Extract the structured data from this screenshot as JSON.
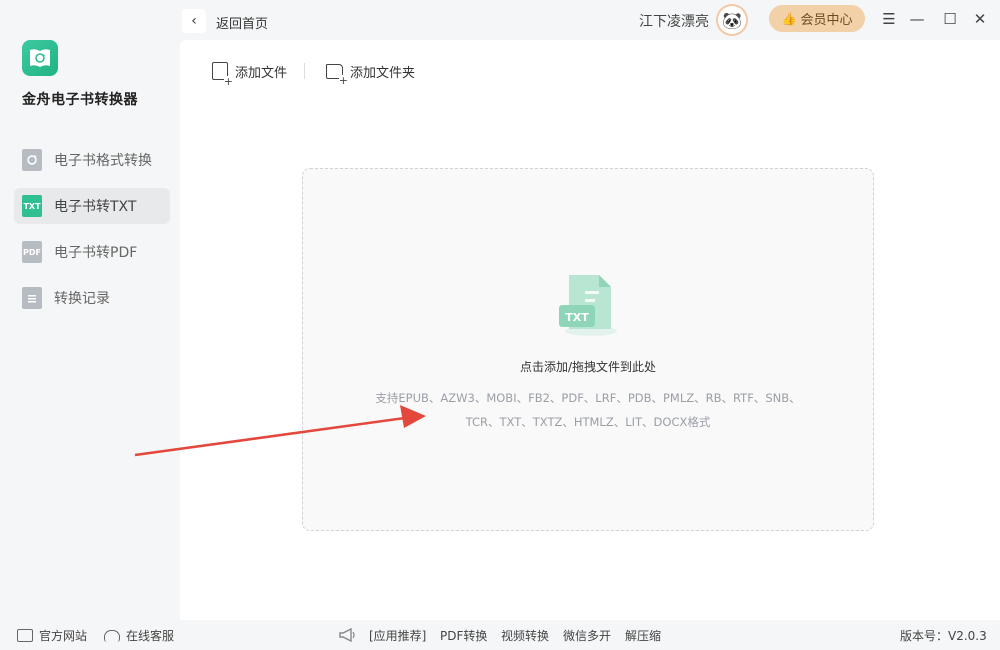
{
  "app": {
    "name": "金舟电子书转换器",
    "accent": "#2fbf91"
  },
  "sidebar": {
    "items": [
      {
        "label": "电子书格式转换",
        "icon": "refresh-book-icon"
      },
      {
        "label": "电子书转TXT",
        "icon": "txt-file-icon",
        "icon_text": "TXT"
      },
      {
        "label": "电子书转PDF",
        "icon": "pdf-file-icon",
        "icon_text": "PDF"
      },
      {
        "label": "转换记录",
        "icon": "list-record-icon"
      }
    ],
    "active": 1
  },
  "header": {
    "back_label": "返回首页",
    "username": "江下凌漂亮",
    "vip_label": "会员中心"
  },
  "toolbar": {
    "add_file": "添加文件",
    "add_folder": "添加文件夹"
  },
  "dropzone": {
    "illustration_text": "TXT",
    "main_text": "点击添加/拖拽文件到此处",
    "formats_line1": "支持EPUB、AZW3、MOBI、FB2、PDF、LRF、PDB、PMLZ、RB、RTF、SNB、",
    "formats_line2": "TCR、TXT、TXTZ、HTMLZ、LIT、DOCX格式"
  },
  "footer": {
    "website": "官方网站",
    "support": "在线客服",
    "recommend": "[应用推荐]",
    "links": [
      "PDF转换",
      "视频转换",
      "微信多开",
      "解压缩"
    ],
    "version": "版本号：V2.0.3"
  }
}
